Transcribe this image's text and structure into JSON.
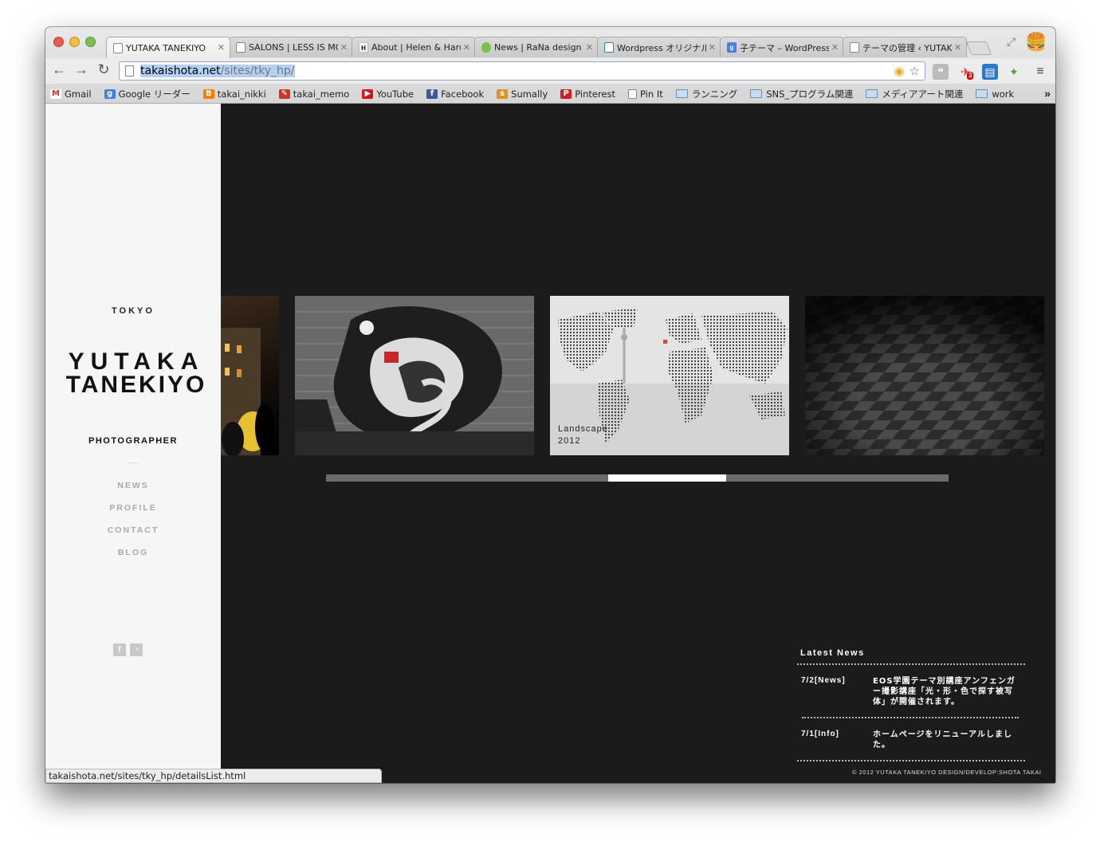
{
  "browser": {
    "tabs": [
      {
        "title": "YUTAKA TANEKIYO",
        "icon": "page-icon",
        "active": true
      },
      {
        "title": "SALONS | LESS IS MORE",
        "icon": "page-icon"
      },
      {
        "title": "About | Helen & Hard",
        "icon": "h-favicon",
        "icon_text": "H"
      },
      {
        "title": "News | RaNa design",
        "icon": "frog-favicon"
      },
      {
        "title": "Wordpress オリジナル",
        "icon": "wp-favicon"
      },
      {
        "title": "子テーマ – WordPress",
        "icon": "google-favicon",
        "icon_text": "g"
      },
      {
        "title": "テーマの管理 ‹ YUTAKA",
        "icon": "page-icon"
      }
    ],
    "url_host": "takaishota.net",
    "url_path": "/sites/tky_hp/",
    "bookmarks": [
      {
        "label": "Gmail",
        "icon": "gmail-icon",
        "icon_text": "M",
        "color": "#d93025"
      },
      {
        "label": "Google リーダー",
        "icon": "google-reader-icon",
        "icon_text": "g",
        "color": "#4a7fe0"
      },
      {
        "label": "takai_nikki",
        "icon": "blogger-icon",
        "icon_text": "B",
        "color": "#f57d00"
      },
      {
        "label": "takai_memo",
        "icon": "memo-icon",
        "icon_text": "✎",
        "color": "#c0392b"
      },
      {
        "label": "YouTube",
        "icon": "youtube-icon",
        "icon_text": "▶",
        "color": "#cc181e"
      },
      {
        "label": "Facebook",
        "icon": "facebook-icon",
        "icon_text": "f",
        "color": "#3b5998"
      },
      {
        "label": "Sumally",
        "icon": "sumally-icon",
        "icon_text": "s",
        "color": "#e0902a"
      },
      {
        "label": "Pinterest",
        "icon": "pinterest-icon",
        "icon_text": "P",
        "color": "#cb2027"
      },
      {
        "label": "Pin It",
        "icon": "page-icon",
        "icon_text": "",
        "color": "#ffffff"
      },
      {
        "label": "ランニング",
        "icon": "folder-icon"
      },
      {
        "label": "SNS_プログラム関連",
        "icon": "folder-icon"
      },
      {
        "label": "メディアアート関連",
        "icon": "folder-icon"
      },
      {
        "label": "work",
        "icon": "folder-icon"
      }
    ],
    "bookmarks_more": "»",
    "status_url": "takaishota.net/sites/tky_hp/detailsList.html",
    "extension_badge": "3"
  },
  "site": {
    "city": "TOKYO",
    "name_line1": "YUTAKA",
    "name_line2": "TANEKIYO",
    "role": "PHOTOGRAPHER",
    "nav": [
      "NEWS",
      "PROFILE",
      "CONTACT",
      "BLOG"
    ],
    "social": [
      {
        "icon": "facebook-icon",
        "glyph": "f"
      },
      {
        "icon": "rss-icon",
        "glyph": "◔"
      }
    ]
  },
  "carousel": {
    "slides": [
      {
        "name": "slide-night-building",
        "caption_title": "",
        "caption_year": ""
      },
      {
        "name": "slide-graffiti-wall",
        "caption_title": "",
        "caption_year": ""
      },
      {
        "name": "slide-world-map",
        "caption_title": "Landscape",
        "caption_year": "2012"
      },
      {
        "name": "slide-checker-pavement",
        "caption_title": "",
        "caption_year": ""
      }
    ],
    "position": 0.56
  },
  "news": {
    "title": "Latest News",
    "items": [
      {
        "date": "7/2[News]",
        "text": "EOS学園テーマ別講座アンフェンガー撮影講座「光・形・色で探す被写体」が開催されます。"
      },
      {
        "date": "7/1[Info]",
        "text": "ホームページをリニューアルしました。"
      }
    ]
  },
  "footer": "© 2012 YUTAKA TANEKIYO   DESIGN/DEVELOP:SHOTA TAKAI"
}
